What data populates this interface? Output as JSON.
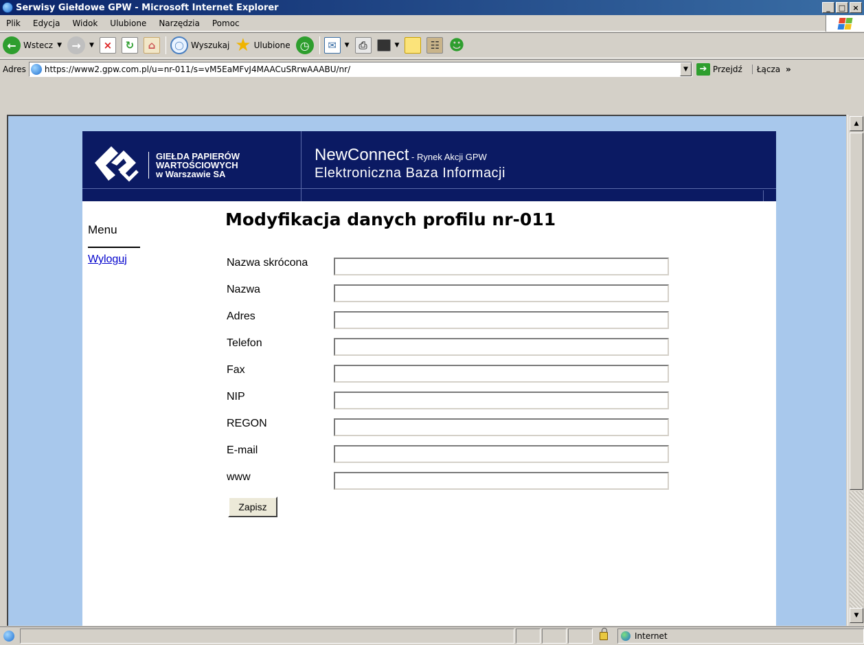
{
  "window": {
    "title": "Serwisy Giełdowe GPW - Microsoft Internet Explorer",
    "min": "_",
    "max": "□",
    "close": "×"
  },
  "menubar": [
    "Plik",
    "Edycja",
    "Widok",
    "Ulubione",
    "Narzędzia",
    "Pomoc"
  ],
  "toolbar": {
    "back_label": "Wstecz",
    "search_label": "Wyszukaj",
    "favorites_label": "Ulubione"
  },
  "address": {
    "label": "Adres",
    "url": "https://www2.gpw.com.pl/u=nr-011/s=vM5EaMFvJ4MAACuSRrwAAABU/nr/",
    "go_label": "Przejdź",
    "links_label": "Łącza",
    "links_more": "»"
  },
  "banner": {
    "org_line1": "GIEŁDA PAPIERÓW",
    "org_line2": "WARTOŚCIOWYCH",
    "org_line3": "w Warszawie SA",
    "product": "NewConnect",
    "product_suffix": " - Rynek Akcji GPW",
    "subtitle": "Elektroniczna Baza Informacji"
  },
  "menu": {
    "heading": "Menu",
    "logout": "Wyloguj"
  },
  "form": {
    "title": "Modyfikacja danych profilu nr-011",
    "fields": [
      {
        "label": "Nazwa skrócona",
        "value": ""
      },
      {
        "label": "Nazwa",
        "value": ""
      },
      {
        "label": "Adres",
        "value": ""
      },
      {
        "label": "Telefon",
        "value": ""
      },
      {
        "label": "Fax",
        "value": ""
      },
      {
        "label": "NIP",
        "value": ""
      },
      {
        "label": "REGON",
        "value": ""
      },
      {
        "label": "E-mail",
        "value": ""
      },
      {
        "label": "www",
        "value": ""
      }
    ],
    "save_label": "Zapisz"
  },
  "status": {
    "zone": "Internet"
  },
  "colors": {
    "banner_bg": "#0b1a63",
    "page_bg": "#a8c8ec",
    "link": "#0000cc"
  }
}
